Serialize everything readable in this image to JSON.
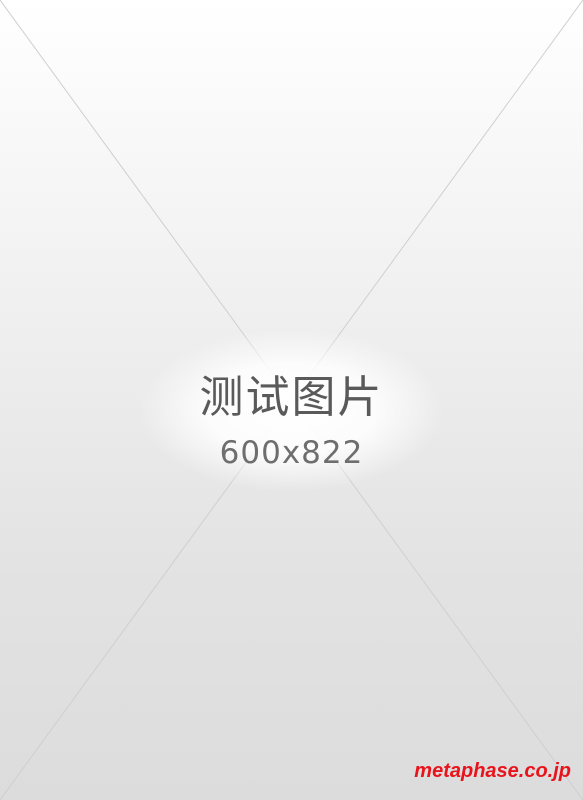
{
  "placeholder": {
    "title": "测试图片",
    "dimensions": "600x822"
  },
  "watermark": {
    "text": "metaphase.co.jp",
    "color": "#e8141c"
  },
  "colors": {
    "background_top": "#ffffff",
    "background_bottom": "#dcdcdc",
    "text": "#5a5a5a",
    "diagonal_lines": "#cfcfcf"
  }
}
